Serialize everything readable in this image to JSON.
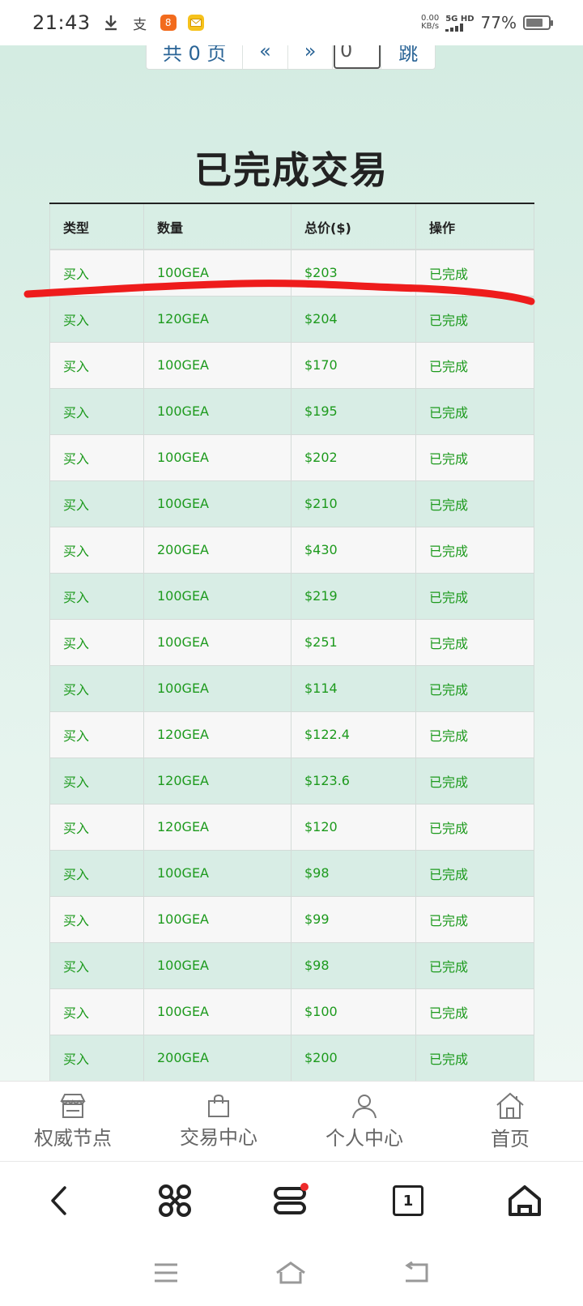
{
  "status_bar": {
    "time": "21:43",
    "alipay_glyph": "支",
    "app_glyph": "8",
    "speed_value": "0.00",
    "speed_unit": "KB/s",
    "network_top": "5G HD",
    "battery_percent": "77%",
    "battery_level": 0.77
  },
  "pager": {
    "total_label": "共 0 页",
    "prev_label": "«",
    "next_label": "»",
    "page_value": "0",
    "jump_label": "跳"
  },
  "page_title": "已完成交易",
  "table": {
    "headers": [
      "类型",
      "数量",
      "总价($)",
      "操作"
    ],
    "rows": [
      [
        "买入",
        "100GEA",
        "$203",
        "已完成"
      ],
      [
        "买入",
        "120GEA",
        "$204",
        "已完成"
      ],
      [
        "买入",
        "100GEA",
        "$170",
        "已完成"
      ],
      [
        "买入",
        "100GEA",
        "$195",
        "已完成"
      ],
      [
        "买入",
        "100GEA",
        "$202",
        "已完成"
      ],
      [
        "买入",
        "100GEA",
        "$210",
        "已完成"
      ],
      [
        "买入",
        "200GEA",
        "$430",
        "已完成"
      ],
      [
        "买入",
        "100GEA",
        "$219",
        "已完成"
      ],
      [
        "买入",
        "100GEA",
        "$251",
        "已完成"
      ],
      [
        "买入",
        "100GEA",
        "$114",
        "已完成"
      ],
      [
        "买入",
        "120GEA",
        "$122.4",
        "已完成"
      ],
      [
        "买入",
        "120GEA",
        "$123.6",
        "已完成"
      ],
      [
        "买入",
        "120GEA",
        "$120",
        "已完成"
      ],
      [
        "买入",
        "100GEA",
        "$98",
        "已完成"
      ],
      [
        "买入",
        "100GEA",
        "$99",
        "已完成"
      ],
      [
        "买入",
        "100GEA",
        "$98",
        "已完成"
      ],
      [
        "买入",
        "100GEA",
        "$100",
        "已完成"
      ],
      [
        "买入",
        "200GEA",
        "$200",
        "已完成"
      ]
    ]
  },
  "tab_bar": {
    "items": [
      {
        "label": "权威节点",
        "icon": "store-icon"
      },
      {
        "label": "交易中心",
        "icon": "shopping-bag-icon"
      },
      {
        "label": "个人中心",
        "icon": "user-icon"
      },
      {
        "label": "首页",
        "icon": "home-icon"
      }
    ]
  },
  "browser_bar": {
    "tab_count": "1",
    "icons": [
      "back-icon",
      "apps-icon",
      "menu-icon",
      "tabs-icon",
      "home-icon"
    ]
  },
  "colors": {
    "page_background": "#d4ece2",
    "row_text": "#1d9a1d",
    "annotation_line": "#ee1c1c",
    "link": "#2a6496"
  }
}
